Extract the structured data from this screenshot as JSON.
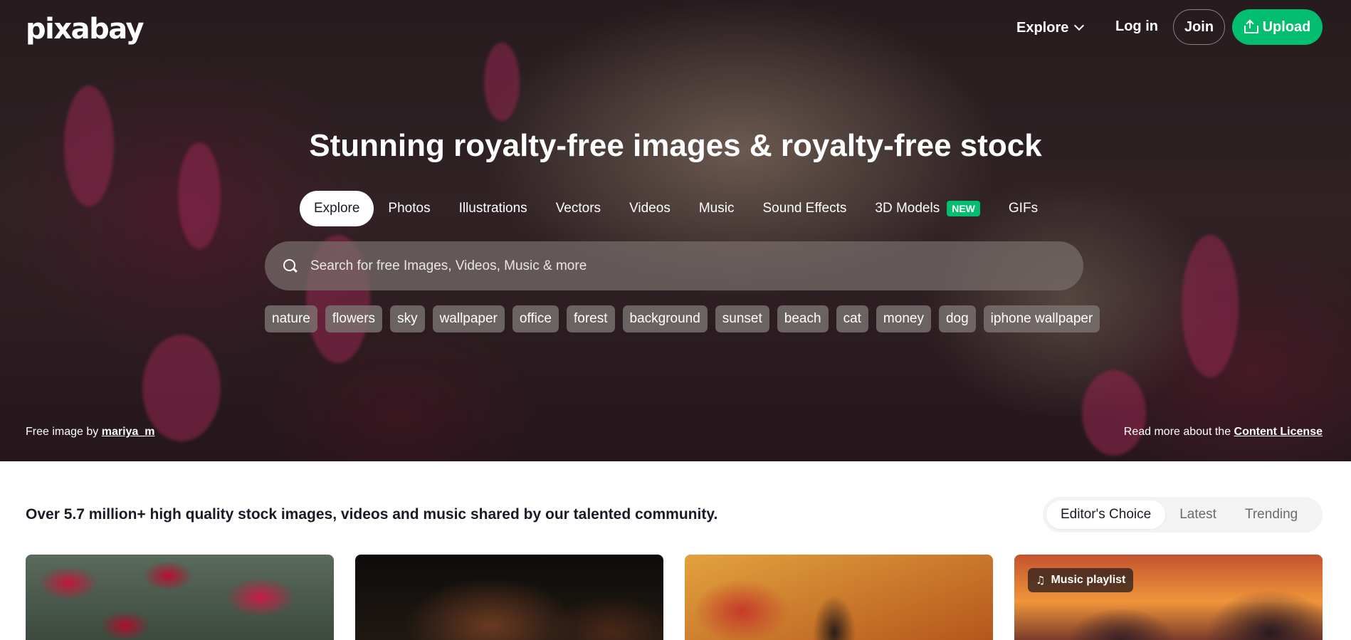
{
  "header": {
    "logo": "pixabay",
    "explore_label": "Explore",
    "login_label": "Log in",
    "join_label": "Join",
    "upload_label": "Upload"
  },
  "hero": {
    "headline": "Stunning royalty-free images & royalty-free stock",
    "tabs": [
      {
        "label": "Explore",
        "active": true
      },
      {
        "label": "Photos"
      },
      {
        "label": "Illustrations"
      },
      {
        "label": "Vectors"
      },
      {
        "label": "Videos"
      },
      {
        "label": "Music"
      },
      {
        "label": "Sound Effects"
      },
      {
        "label": "3D Models",
        "badge": "NEW"
      },
      {
        "label": "GIFs"
      }
    ],
    "search": {
      "placeholder": "Search for free Images, Videos, Music & more",
      "value": ""
    },
    "tags": [
      "nature",
      "flowers",
      "sky",
      "wallpaper",
      "office",
      "forest",
      "background",
      "sunset",
      "beach",
      "cat",
      "money",
      "dog",
      "iphone wallpaper"
    ],
    "credit_prefix": "Free image by ",
    "credit_author": "mariya_m",
    "license_prefix": "Read more about the ",
    "license_link": "Content License"
  },
  "main": {
    "tagline": "Over 5.7 million+ high quality stock images, videos and music shared by our talented community.",
    "sort_options": [
      {
        "label": "Editor's Choice",
        "active": true
      },
      {
        "label": "Latest"
      },
      {
        "label": "Trending"
      }
    ],
    "cards": [
      {
        "badge": ""
      },
      {
        "badge": ""
      },
      {
        "badge": ""
      },
      {
        "badge": "Music playlist",
        "badge_icon": "music-note-icon"
      }
    ]
  },
  "colors": {
    "accent": "#02be6e",
    "text_dark": "#191b26"
  }
}
